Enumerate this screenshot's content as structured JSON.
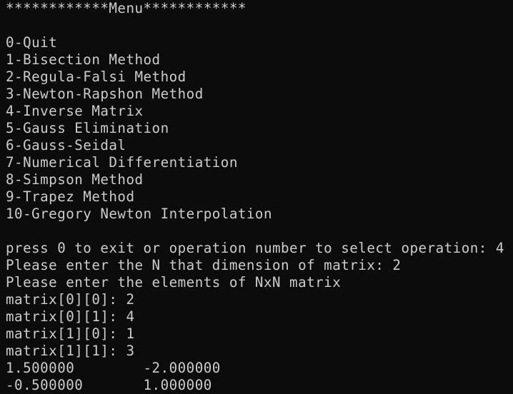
{
  "terminal": {
    "menu_header": "************Menu************",
    "menu_items": [
      "0-Quit",
      "1-Bisection Method",
      "2-Regula-Falsi Method",
      "3-Newton-Rapshon Method",
      "4-Inverse Matrix",
      "5-Gauss Elimination",
      "6-Gauss-Seidal",
      "7-Numerical Differentiation",
      "8-Simpson Method",
      "9-Trapez Method",
      "10-Gregory Newton Interpolation"
    ],
    "prompt_operation": "press 0 to exit or operation number to select operation: 4",
    "prompt_dimension": "Please enter the N that dimension of matrix: 2",
    "prompt_elements": "Please enter the elements of NxN matrix",
    "matrix_inputs": [
      "matrix[0][0]: 2",
      "matrix[0][1]: 4",
      "matrix[1][0]: 1",
      "matrix[1][1]: 3"
    ],
    "result_rows": [
      "1.500000        -2.000000",
      "-0.500000       1.000000"
    ]
  }
}
